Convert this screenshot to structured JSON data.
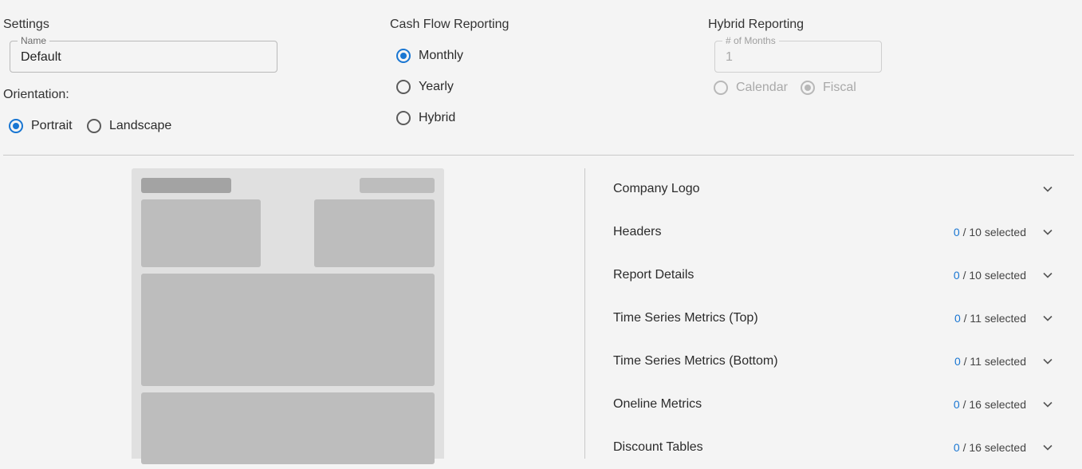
{
  "settings": {
    "title": "Settings",
    "name_field": {
      "legend": "Name",
      "value": "Default"
    },
    "orientation_label": "Orientation:",
    "orientation_options": [
      {
        "label": "Portrait",
        "checked": true
      },
      {
        "label": "Landscape",
        "checked": false
      }
    ]
  },
  "cash_flow": {
    "title": "Cash Flow Reporting",
    "options": [
      {
        "label": "Monthly",
        "checked": true
      },
      {
        "label": "Yearly",
        "checked": false
      },
      {
        "label": "Hybrid",
        "checked": false
      }
    ]
  },
  "hybrid": {
    "title": "Hybrid Reporting",
    "months_field": {
      "legend": "# of Months",
      "value": "1"
    },
    "options": [
      {
        "label": "Calendar",
        "checked": false
      },
      {
        "label": "Fiscal",
        "checked": true
      }
    ]
  },
  "sections": [
    {
      "title": "Company Logo",
      "selected": null,
      "total": null
    },
    {
      "title": "Headers",
      "selected": "0",
      "total": "/ 10 selected"
    },
    {
      "title": "Report Details",
      "selected": "0",
      "total": "/ 10 selected"
    },
    {
      "title": "Time Series Metrics (Top)",
      "selected": "0",
      "total": "/ 11 selected"
    },
    {
      "title": "Time Series Metrics (Bottom)",
      "selected": "0",
      "total": "/ 11 selected"
    },
    {
      "title": "Oneline Metrics",
      "selected": "0",
      "total": "/ 16 selected"
    },
    {
      "title": "Discount Tables",
      "selected": "0",
      "total": "/ 16 selected"
    }
  ],
  "colors": {
    "accent": "#1976d2",
    "preview_bg": "#e0e0e0",
    "preview_block": "#bdbdbd"
  },
  "icons": {
    "expand": "chevron-down-icon"
  }
}
